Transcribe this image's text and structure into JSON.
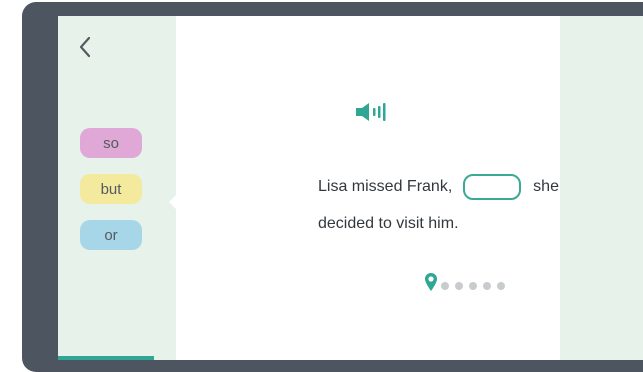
{
  "app": {
    "back_icon": "chevron-left-icon",
    "audio_icon": "speaker-icon",
    "accent_color": "#3aaa96"
  },
  "options": [
    {
      "label": "so",
      "color": "#dfa8d6"
    },
    {
      "label": "but",
      "color": "#f3ea9e"
    },
    {
      "label": "or",
      "color": "#a7d6e8"
    }
  ],
  "sentence": {
    "before_blank": "Lisa missed Frank,",
    "after_blank": "she",
    "line2": "decided to visit him."
  },
  "progress": {
    "current_step": 1,
    "remaining_dots": 5,
    "current_icon": "location-pin-icon"
  }
}
